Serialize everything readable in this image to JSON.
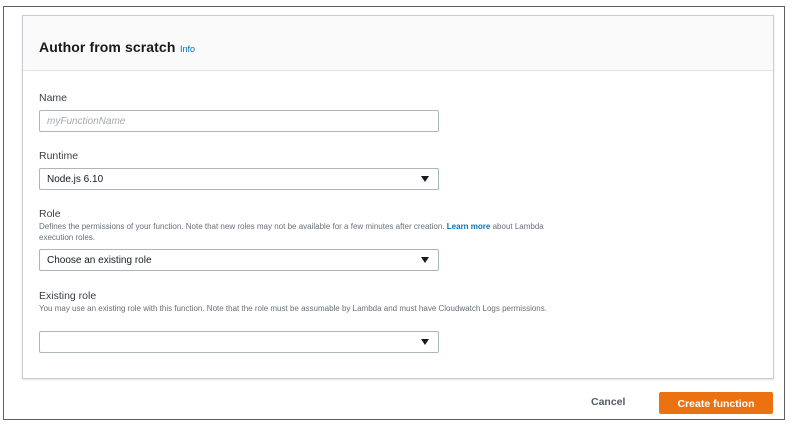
{
  "panel": {
    "title": "Author from scratch",
    "info_link": "Info"
  },
  "form": {
    "name": {
      "label": "Name",
      "placeholder": "myFunctionName",
      "value": ""
    },
    "runtime": {
      "label": "Runtime",
      "selected": "Node.js 6.10"
    },
    "role": {
      "label": "Role",
      "description_text": "Defines the permissions of your function. Note that new roles may not be available for a few minutes after creation.",
      "description_link": "Learn more",
      "description_suffix": "about Lambda execution roles.",
      "selected": "Choose an existing role"
    },
    "existing_role": {
      "label": "Existing role",
      "description": "You may use an existing role with this function. Note that the role must be assumable by Lambda and must have Cloudwatch Logs permissions.",
      "selected": ""
    }
  },
  "footer": {
    "cancel_label": "Cancel",
    "create_label": "Create function"
  },
  "colors": {
    "primary_button": "#ec7211",
    "link": "#0073bb"
  },
  "icons": {
    "dropdown": "caret-down-icon"
  }
}
